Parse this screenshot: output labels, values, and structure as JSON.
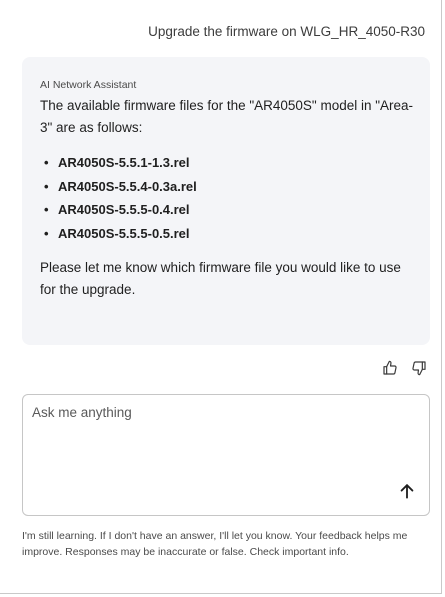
{
  "user_message": "Upgrade the firmware on WLG_HR_4050-R30",
  "assistant": {
    "sender": "AI Network Assistant",
    "intro": "The available firmware files for the \"AR4050S\" model in \"Area-3\" are as follows:",
    "files": [
      "AR4050S-5.5.1-1.3.rel",
      "AR4050S-5.5.4-0.3a.rel",
      "AR4050S-5.5.5-0.4.rel",
      "AR4050S-5.5.5-0.5.rel"
    ],
    "outro": "Please let me know which firmware file you would like to use for the upgrade."
  },
  "feedback": {
    "thumbs_up_icon": "thumbs-up-icon",
    "thumbs_down_icon": "thumbs-down-icon"
  },
  "composer": {
    "placeholder": "Ask me anything",
    "value": "",
    "send_icon": "arrow-up-icon"
  },
  "disclaimer": "I'm still learning. If I don't have an answer, I'll let you know. Your feedback helps me improve. Responses may be inaccurate or false. Check important info."
}
